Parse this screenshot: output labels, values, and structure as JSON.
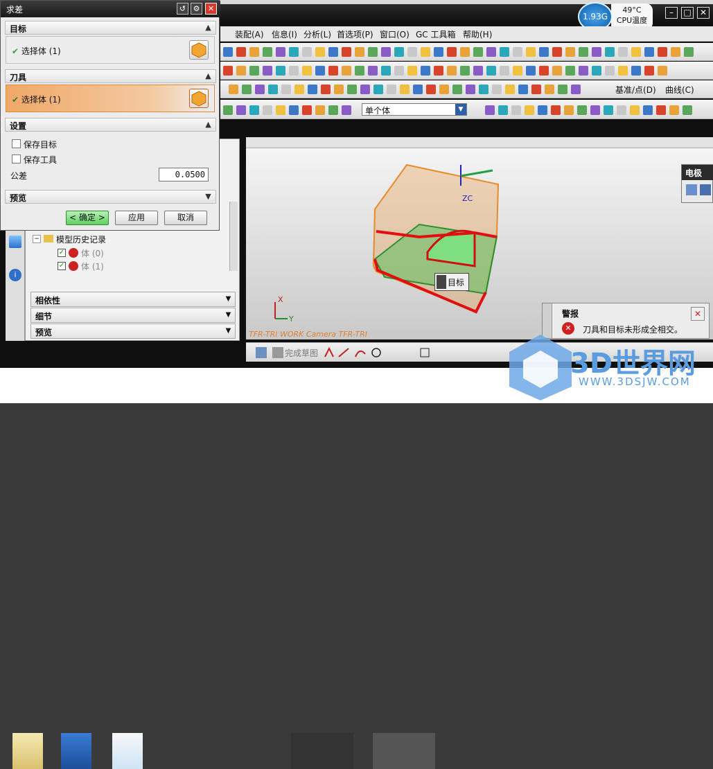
{
  "dialog": {
    "title": "求差",
    "sections": {
      "target": "目标",
      "tool": "刀具",
      "settings": "设置",
      "preview": "预览"
    },
    "target_selection": "选择体 (1)",
    "tool_selection": "选择体 (1)",
    "keep_target": "保存目标",
    "keep_tool": "保存工具",
    "tolerance_label": "公差",
    "tolerance_value": "0.0500",
    "ok_button": "< 确定 >",
    "apply_button": "应用",
    "cancel_button": "取消"
  },
  "cpu_widget": {
    "usage": "1.93G",
    "temp": "49°C",
    "label": "CPU温度"
  },
  "menubar": {
    "items": [
      "装配(A)",
      "信息(I)",
      "分析(L)",
      "首选项(P)",
      "窗口(O)",
      "GC 工具箱",
      "帮助(H)"
    ]
  },
  "toolbar": {
    "selection_filter": "单个体",
    "datum_point_menu": "基准/点(D)",
    "curve_menu": "曲线(C)"
  },
  "navigator": {
    "history_label": "模型历史记录",
    "body0": "体 (0)",
    "body1": "体 (1)",
    "dependencies": "相依性",
    "details": "细节",
    "preview": "预览"
  },
  "viewport": {
    "target_tag": "目标",
    "zc_label": "ZC",
    "camera_label": "TFR-TRI WORK Camera TFR-TRI",
    "axis_x": "X",
    "axis_y": "Y"
  },
  "sketchbar": {
    "finish_sketch": "完成草图"
  },
  "warning": {
    "title": "警报",
    "message": "刀具和目标未形成全相交。"
  },
  "right_panel": {
    "title": "电极"
  },
  "watermark": {
    "brand": "3D世界网",
    "url": "WWW.3DSJW.COM"
  },
  "colors": {
    "accent_orange": "#e8a050",
    "ok_green": "#3c9a3c",
    "error_red": "#d02020"
  }
}
